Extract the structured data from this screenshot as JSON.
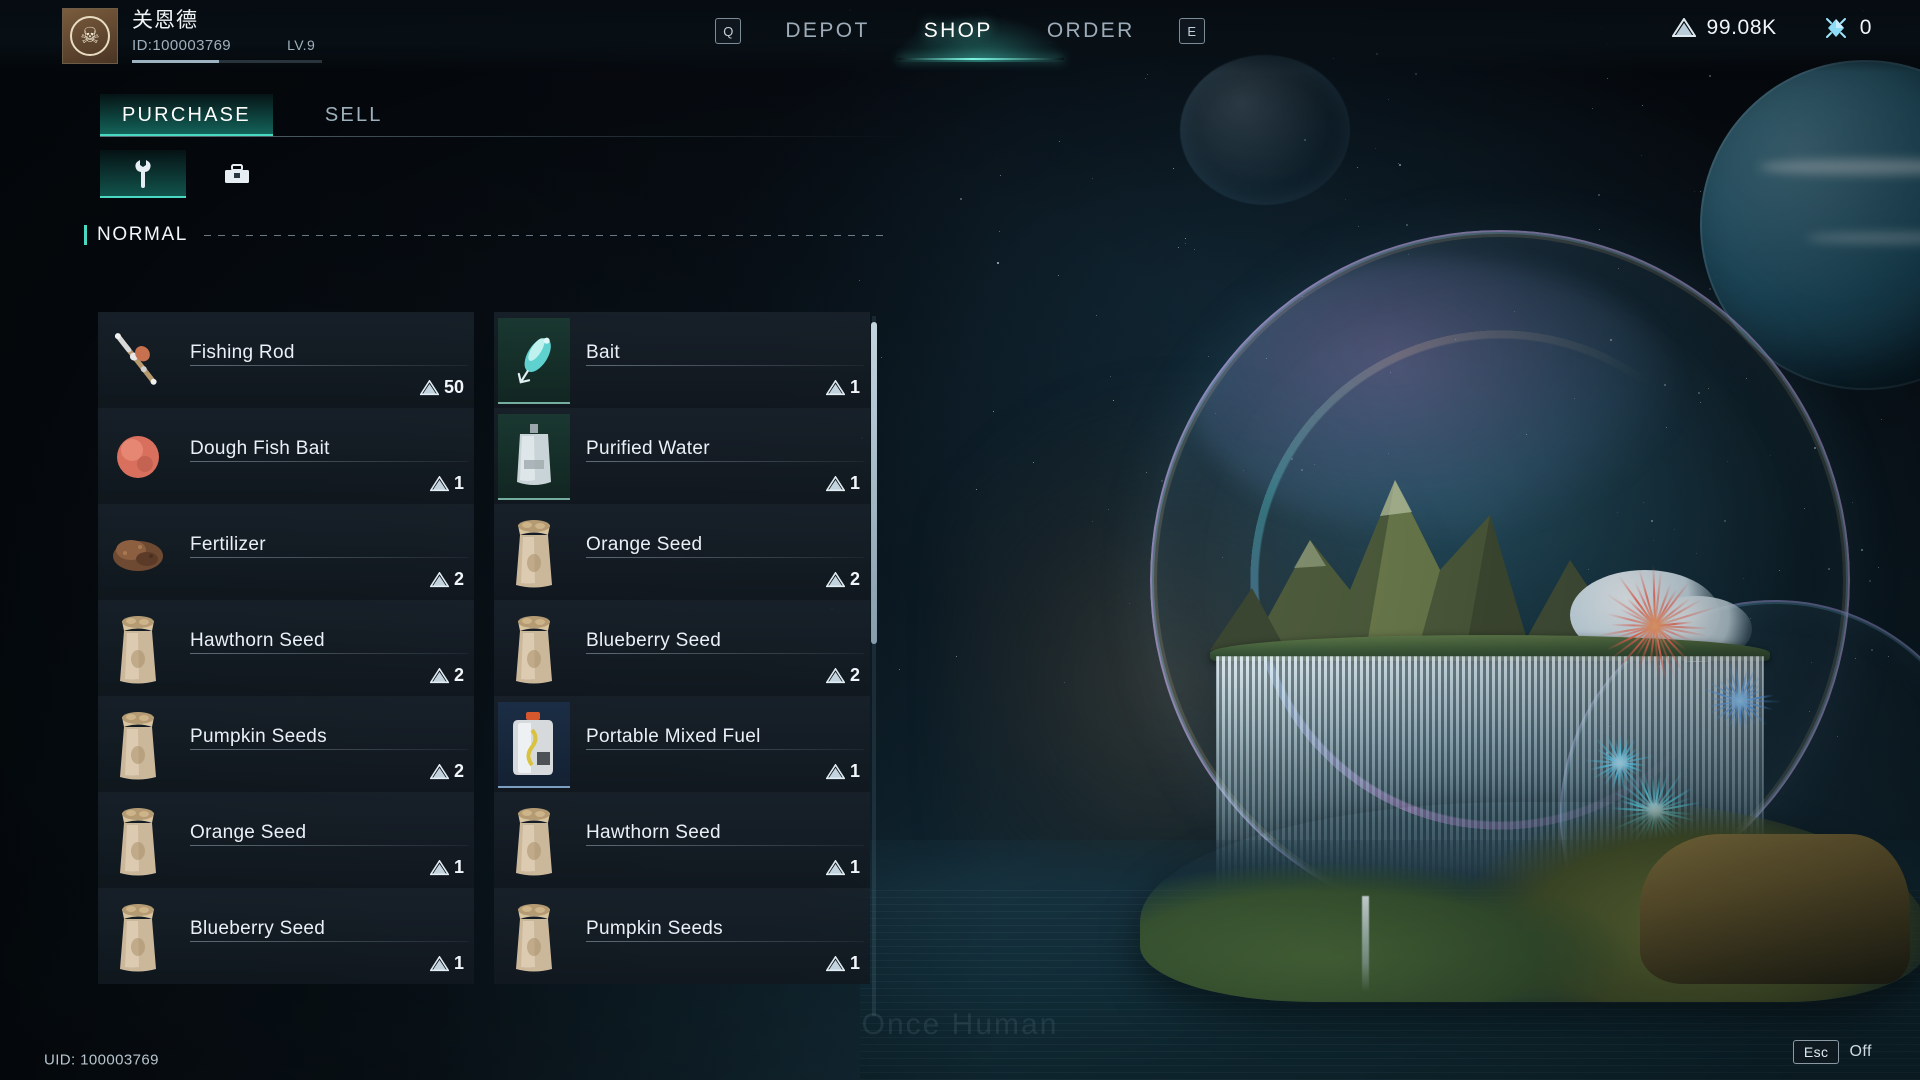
{
  "profile": {
    "name": "关恩德",
    "id": "ID:100003769",
    "level": "LV.9",
    "avatar_icon": "skull-emblem-avatar"
  },
  "nav": {
    "left_key": "Q",
    "right_key": "E",
    "items": [
      {
        "label": "DEPOT",
        "active": false
      },
      {
        "label": "SHOP",
        "active": true
      },
      {
        "label": "ORDER",
        "active": false
      }
    ]
  },
  "currencies": [
    {
      "icon": "mountain-currency-icon",
      "value": "99.08K"
    },
    {
      "icon": "crystal-currency-icon",
      "value": "0"
    }
  ],
  "shop": {
    "tabs": [
      {
        "label": "PURCHASE",
        "active": true
      },
      {
        "label": "SELL",
        "active": false
      }
    ],
    "categories": [
      {
        "icon": "wrench-icon",
        "active": true
      },
      {
        "icon": "toolbox-icon",
        "active": false
      }
    ],
    "section_label": "NORMAL",
    "items": [
      {
        "name": "Fishing Rod",
        "price": "50",
        "icon": "fishing-rod-icon",
        "rarity": "none"
      },
      {
        "name": "Bait",
        "price": "1",
        "icon": "lure-bait-icon",
        "rarity": "green"
      },
      {
        "name": "Dough Fish Bait",
        "price": "1",
        "icon": "dough-ball-icon",
        "rarity": "none"
      },
      {
        "name": "Purified Water",
        "price": "1",
        "icon": "water-pouch-icon",
        "rarity": "green"
      },
      {
        "name": "Fertilizer",
        "price": "2",
        "icon": "fertilizer-icon",
        "rarity": "none"
      },
      {
        "name": "Orange Seed",
        "price": "2",
        "icon": "seed-bag-icon",
        "rarity": "none"
      },
      {
        "name": "Hawthorn Seed",
        "price": "2",
        "icon": "seed-bag-icon",
        "rarity": "none"
      },
      {
        "name": "Blueberry Seed",
        "price": "2",
        "icon": "seed-bag-icon",
        "rarity": "none"
      },
      {
        "name": "Pumpkin Seeds",
        "price": "2",
        "icon": "seed-bag-icon",
        "rarity": "none"
      },
      {
        "name": "Portable Mixed Fuel",
        "price": "1",
        "icon": "fuel-jug-icon",
        "rarity": "blue"
      },
      {
        "name": "Orange Seed",
        "price": "1",
        "icon": "seed-bag-icon",
        "rarity": "none"
      },
      {
        "name": "Hawthorn Seed",
        "price": "1",
        "icon": "seed-bag-icon",
        "rarity": "none"
      },
      {
        "name": "Blueberry Seed",
        "price": "1",
        "icon": "seed-bag-icon",
        "rarity": "none"
      },
      {
        "name": "Pumpkin Seeds",
        "price": "1",
        "icon": "seed-bag-icon",
        "rarity": "none"
      }
    ]
  },
  "footer": {
    "uid": "UID: 100003769",
    "esc_key": "Esc",
    "esc_action": "Off"
  },
  "colors": {
    "accent_teal": "#49d9c2",
    "panel_bg": "#151d25",
    "text_primary": "#eaf0f5",
    "text_muted": "#9eb0bb"
  }
}
